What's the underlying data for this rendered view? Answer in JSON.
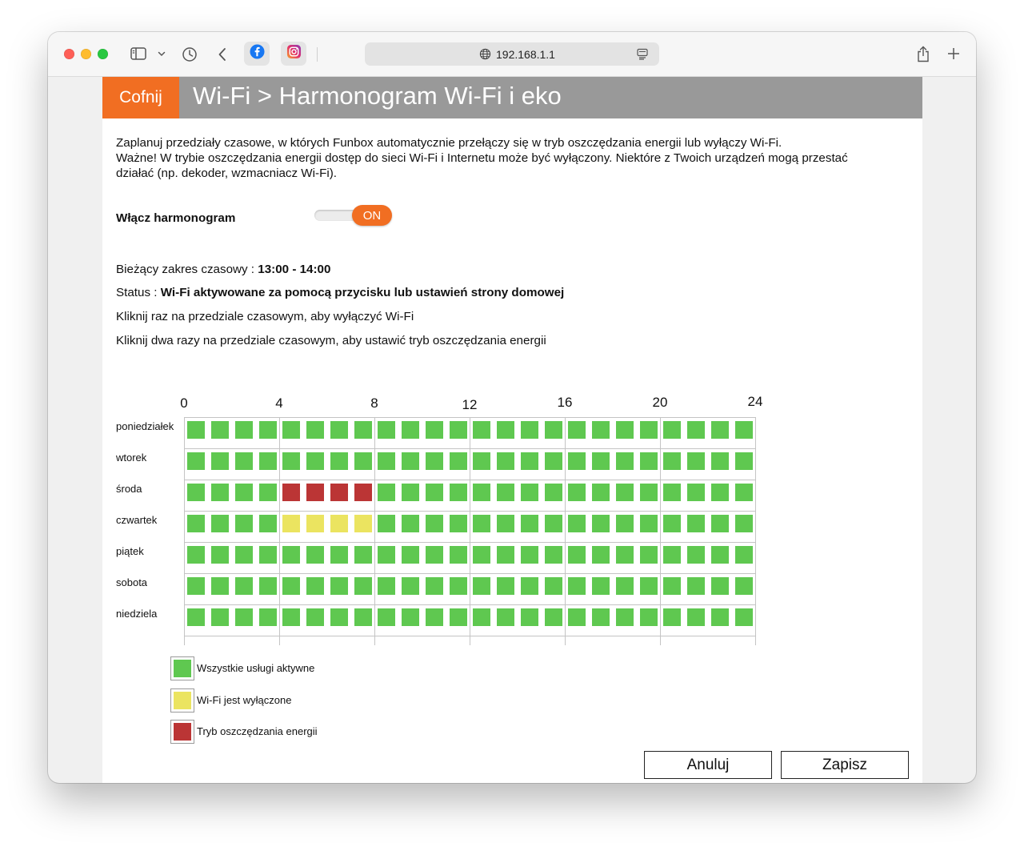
{
  "browser": {
    "url": "192.168.1.1",
    "favorites": [
      "facebook-icon",
      "instagram-icon"
    ]
  },
  "header": {
    "back_label": "Cofnij",
    "title": "Wi-Fi > Harmonogram Wi-Fi i eko"
  },
  "description": {
    "line1": "Zaplanuj przedziały czasowe, w których Funbox automatycznie przełączy się w tryb oszczędzania energii lub wyłączy Wi-Fi.",
    "line2": "Ważne! W trybie oszczędzania energii dostęp do sieci Wi-Fi i Internetu może być wyłączony. Niektóre z Twoich urządzeń mogą przestać",
    "line3": "działać (np. dekoder, wzmacniacz Wi-Fi)."
  },
  "schedule_toggle": {
    "label": "Włącz harmonogram",
    "state": "ON"
  },
  "info": {
    "range_label": "Bieżący zakres czasowy : ",
    "range_value": "13:00 - 14:00",
    "status_label": "Status : ",
    "status_value": "Wi-Fi aktywowane za pomocą przycisku lub ustawień strony domowej",
    "hint1": "Kliknij raz na przedziale czasowym, aby wyłączyć Wi-Fi",
    "hint2": "Kliknij dwa razy na przedziale czasowym, aby ustawić tryb oszczędzania energii"
  },
  "grid": {
    "hour_labels": [
      "0",
      "4",
      "8",
      "12",
      "16",
      "20",
      "24"
    ],
    "days": [
      {
        "name": "poniedziałek",
        "slots": "GGGGGGGGGGGGGGGGGGGGGGGG"
      },
      {
        "name": "wtorek",
        "slots": "GGGGGGGGGGGGGGGGGGGGGGGG"
      },
      {
        "name": "środa",
        "slots": "GGGGRRRRGGGGGGGGGGGGGGGG"
      },
      {
        "name": "czwartek",
        "slots": "GGGGYYYYGGGGGGGGGGGGGGGG"
      },
      {
        "name": "piątek",
        "slots": "GGGGGGGGGGGGGGGGGGGGGGGG"
      },
      {
        "name": "sobota",
        "slots": "GGGGGGGGGGGGGGGGGGGGGGGG"
      },
      {
        "name": "niedziela",
        "slots": "GGGGGGGGGGGGGGGGGGGGGGGG"
      }
    ],
    "slot_codes": {
      "G": "active",
      "Y": "wifi-off",
      "R": "eco"
    }
  },
  "legend": [
    {
      "label": "Wszystkie usługi aktywne",
      "color": "#5fc850"
    },
    {
      "label": "Wi-Fi jest wyłączone",
      "color": "#ebe460"
    },
    {
      "label": "Tryb oszczędzania energii",
      "color": "#bb3535"
    }
  ],
  "buttons": {
    "cancel": "Anuluj",
    "save": "Zapisz"
  },
  "colors": {
    "accent": "#f16e22",
    "header_bg": "#999999"
  }
}
